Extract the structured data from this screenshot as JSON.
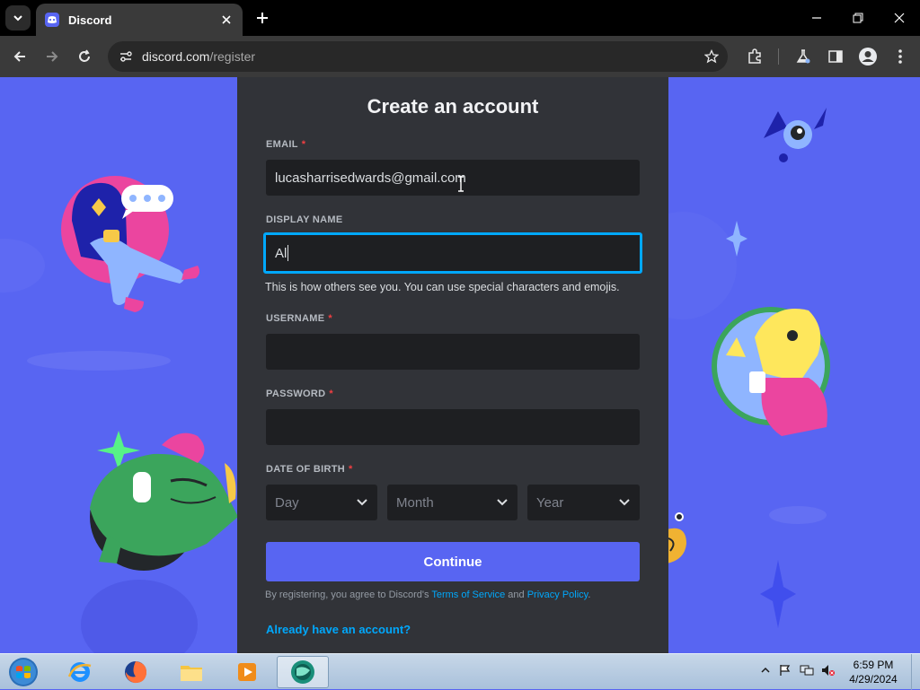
{
  "browser": {
    "tab_title": "Discord",
    "url_domain": "discord.com",
    "url_path": "/register"
  },
  "form": {
    "title": "Create an account",
    "email": {
      "label": "EMAIL",
      "required_mark": "*",
      "value": "lucasharrisedwards@gmail.com"
    },
    "display_name": {
      "label": "DISPLAY NAME",
      "value": "Al",
      "hint": "This is how others see you. You can use special characters and emojis."
    },
    "username": {
      "label": "USERNAME",
      "required_mark": "*",
      "value": ""
    },
    "password": {
      "label": "PASSWORD",
      "required_mark": "*",
      "value": ""
    },
    "dob": {
      "label": "DATE OF BIRTH",
      "required_mark": "*",
      "day": "Day",
      "month": "Month",
      "year": "Year"
    },
    "continue_label": "Continue",
    "terms_prefix": "By registering, you agree to Discord's ",
    "terms_link": "Terms of Service",
    "terms_and": " and ",
    "privacy_link": "Privacy Policy",
    "terms_suffix": ".",
    "login_link": "Already have an account?"
  },
  "taskbar": {
    "time": "6:59 PM",
    "date": "4/29/2024"
  },
  "colors": {
    "blurple": "#5865f2",
    "card": "#313338",
    "input": "#1e1f22",
    "focus": "#00a8fc",
    "required": "#f23f42"
  }
}
